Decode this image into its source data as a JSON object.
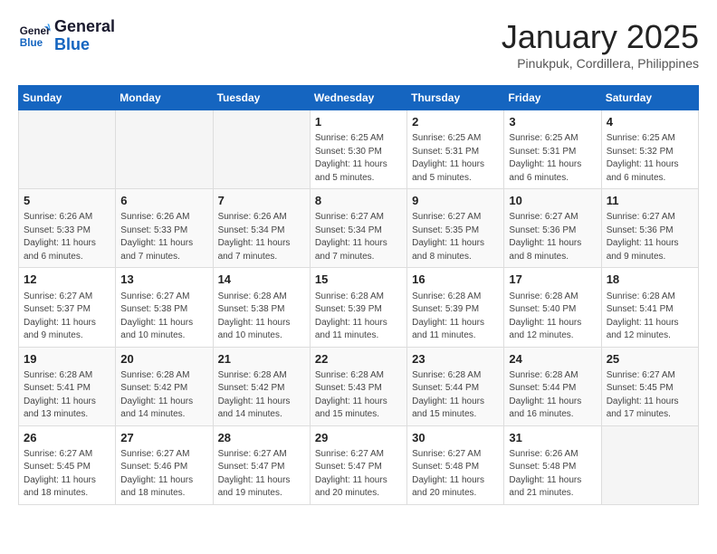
{
  "header": {
    "logo_line1": "General",
    "logo_line2": "Blue",
    "month": "January 2025",
    "location": "Pinukpuk, Cordillera, Philippines"
  },
  "weekdays": [
    "Sunday",
    "Monday",
    "Tuesday",
    "Wednesday",
    "Thursday",
    "Friday",
    "Saturday"
  ],
  "weeks": [
    [
      {
        "day": "",
        "info": ""
      },
      {
        "day": "",
        "info": ""
      },
      {
        "day": "",
        "info": ""
      },
      {
        "day": "1",
        "info": "Sunrise: 6:25 AM\nSunset: 5:30 PM\nDaylight: 11 hours\nand 5 minutes."
      },
      {
        "day": "2",
        "info": "Sunrise: 6:25 AM\nSunset: 5:31 PM\nDaylight: 11 hours\nand 5 minutes."
      },
      {
        "day": "3",
        "info": "Sunrise: 6:25 AM\nSunset: 5:31 PM\nDaylight: 11 hours\nand 6 minutes."
      },
      {
        "day": "4",
        "info": "Sunrise: 6:25 AM\nSunset: 5:32 PM\nDaylight: 11 hours\nand 6 minutes."
      }
    ],
    [
      {
        "day": "5",
        "info": "Sunrise: 6:26 AM\nSunset: 5:33 PM\nDaylight: 11 hours\nand 6 minutes."
      },
      {
        "day": "6",
        "info": "Sunrise: 6:26 AM\nSunset: 5:33 PM\nDaylight: 11 hours\nand 7 minutes."
      },
      {
        "day": "7",
        "info": "Sunrise: 6:26 AM\nSunset: 5:34 PM\nDaylight: 11 hours\nand 7 minutes."
      },
      {
        "day": "8",
        "info": "Sunrise: 6:27 AM\nSunset: 5:34 PM\nDaylight: 11 hours\nand 7 minutes."
      },
      {
        "day": "9",
        "info": "Sunrise: 6:27 AM\nSunset: 5:35 PM\nDaylight: 11 hours\nand 8 minutes."
      },
      {
        "day": "10",
        "info": "Sunrise: 6:27 AM\nSunset: 5:36 PM\nDaylight: 11 hours\nand 8 minutes."
      },
      {
        "day": "11",
        "info": "Sunrise: 6:27 AM\nSunset: 5:36 PM\nDaylight: 11 hours\nand 9 minutes."
      }
    ],
    [
      {
        "day": "12",
        "info": "Sunrise: 6:27 AM\nSunset: 5:37 PM\nDaylight: 11 hours\nand 9 minutes."
      },
      {
        "day": "13",
        "info": "Sunrise: 6:27 AM\nSunset: 5:38 PM\nDaylight: 11 hours\nand 10 minutes."
      },
      {
        "day": "14",
        "info": "Sunrise: 6:28 AM\nSunset: 5:38 PM\nDaylight: 11 hours\nand 10 minutes."
      },
      {
        "day": "15",
        "info": "Sunrise: 6:28 AM\nSunset: 5:39 PM\nDaylight: 11 hours\nand 11 minutes."
      },
      {
        "day": "16",
        "info": "Sunrise: 6:28 AM\nSunset: 5:39 PM\nDaylight: 11 hours\nand 11 minutes."
      },
      {
        "day": "17",
        "info": "Sunrise: 6:28 AM\nSunset: 5:40 PM\nDaylight: 11 hours\nand 12 minutes."
      },
      {
        "day": "18",
        "info": "Sunrise: 6:28 AM\nSunset: 5:41 PM\nDaylight: 11 hours\nand 12 minutes."
      }
    ],
    [
      {
        "day": "19",
        "info": "Sunrise: 6:28 AM\nSunset: 5:41 PM\nDaylight: 11 hours\nand 13 minutes."
      },
      {
        "day": "20",
        "info": "Sunrise: 6:28 AM\nSunset: 5:42 PM\nDaylight: 11 hours\nand 14 minutes."
      },
      {
        "day": "21",
        "info": "Sunrise: 6:28 AM\nSunset: 5:42 PM\nDaylight: 11 hours\nand 14 minutes."
      },
      {
        "day": "22",
        "info": "Sunrise: 6:28 AM\nSunset: 5:43 PM\nDaylight: 11 hours\nand 15 minutes."
      },
      {
        "day": "23",
        "info": "Sunrise: 6:28 AM\nSunset: 5:44 PM\nDaylight: 11 hours\nand 15 minutes."
      },
      {
        "day": "24",
        "info": "Sunrise: 6:28 AM\nSunset: 5:44 PM\nDaylight: 11 hours\nand 16 minutes."
      },
      {
        "day": "25",
        "info": "Sunrise: 6:27 AM\nSunset: 5:45 PM\nDaylight: 11 hours\nand 17 minutes."
      }
    ],
    [
      {
        "day": "26",
        "info": "Sunrise: 6:27 AM\nSunset: 5:45 PM\nDaylight: 11 hours\nand 18 minutes."
      },
      {
        "day": "27",
        "info": "Sunrise: 6:27 AM\nSunset: 5:46 PM\nDaylight: 11 hours\nand 18 minutes."
      },
      {
        "day": "28",
        "info": "Sunrise: 6:27 AM\nSunset: 5:47 PM\nDaylight: 11 hours\nand 19 minutes."
      },
      {
        "day": "29",
        "info": "Sunrise: 6:27 AM\nSunset: 5:47 PM\nDaylight: 11 hours\nand 20 minutes."
      },
      {
        "day": "30",
        "info": "Sunrise: 6:27 AM\nSunset: 5:48 PM\nDaylight: 11 hours\nand 20 minutes."
      },
      {
        "day": "31",
        "info": "Sunrise: 6:26 AM\nSunset: 5:48 PM\nDaylight: 11 hours\nand 21 minutes."
      },
      {
        "day": "",
        "info": ""
      }
    ]
  ]
}
